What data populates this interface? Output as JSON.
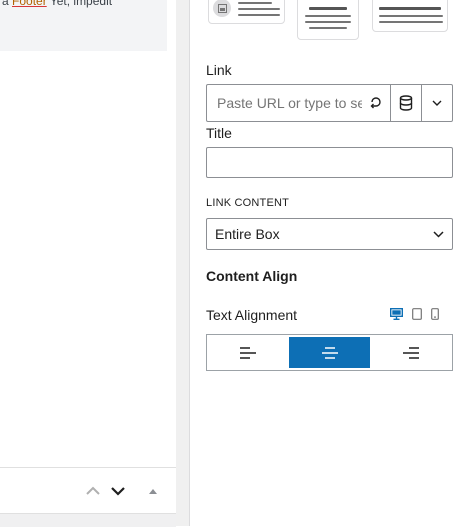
{
  "editor": {
    "top_fragment_left": "a ",
    "top_fragment_mid": "Footer",
    "top_fragment_right": " Yet, impedit"
  },
  "sidebar": {
    "link": {
      "label": "Link",
      "placeholder": "Paste URL or type to search"
    },
    "title": {
      "label": "Title",
      "value": ""
    },
    "link_content": {
      "label": "LINK CONTENT",
      "selected": "Entire Box"
    },
    "content_align": {
      "heading": "Content Align"
    },
    "text_alignment": {
      "label": "Text Alignment",
      "options": [
        "left",
        "center",
        "right"
      ],
      "active": "center",
      "devices": [
        "desktop",
        "tablet",
        "mobile"
      ],
      "active_device": "desktop"
    }
  },
  "colors": {
    "accent": "#0d6fb5",
    "border": "#8c8f94"
  }
}
